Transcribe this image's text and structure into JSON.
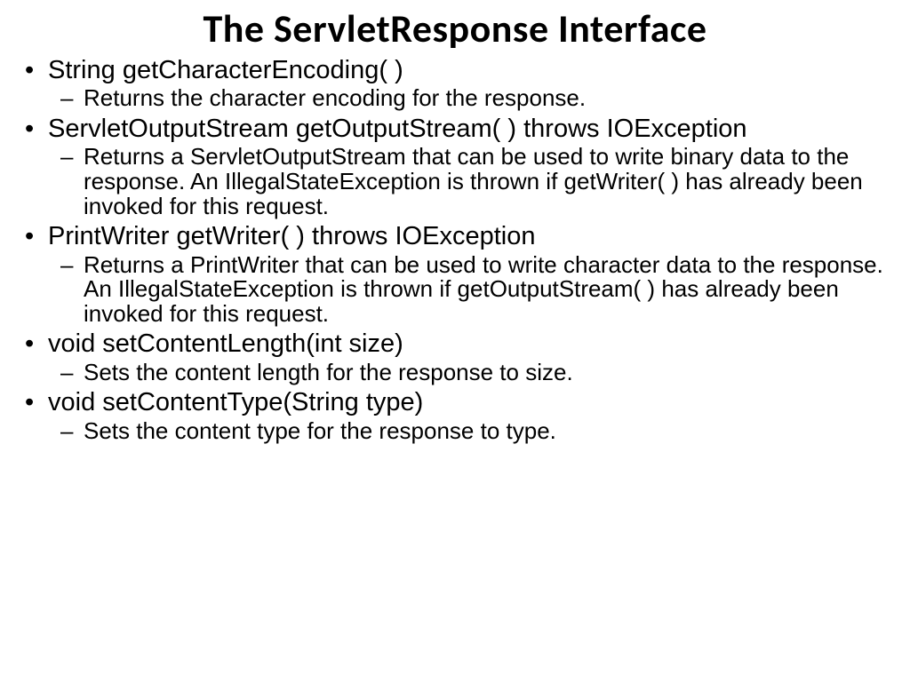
{
  "title": "The ServletResponse Interface",
  "items": [
    {
      "method": "String getCharacterEncoding( )",
      "desc": "Returns the character encoding for the response."
    },
    {
      "method": "ServletOutputStream getOutputStream( ) throws IOException",
      "desc": "Returns a ServletOutputStream that can be used to write binary data to the response. An IllegalStateException is thrown if getWriter( ) has already been invoked for this request."
    },
    {
      "method": "PrintWriter getWriter( ) throws IOException",
      "desc": "Returns a PrintWriter that can be used to write character data to the response. An IllegalStateException is thrown if getOutputStream( ) has already been invoked for this request."
    },
    {
      "method": "void setContentLength(int size)",
      "desc": "Sets the content length for the response to size."
    },
    {
      "method": "void setContentType(String type)",
      "desc": "Sets the content type for the response to type."
    }
  ]
}
